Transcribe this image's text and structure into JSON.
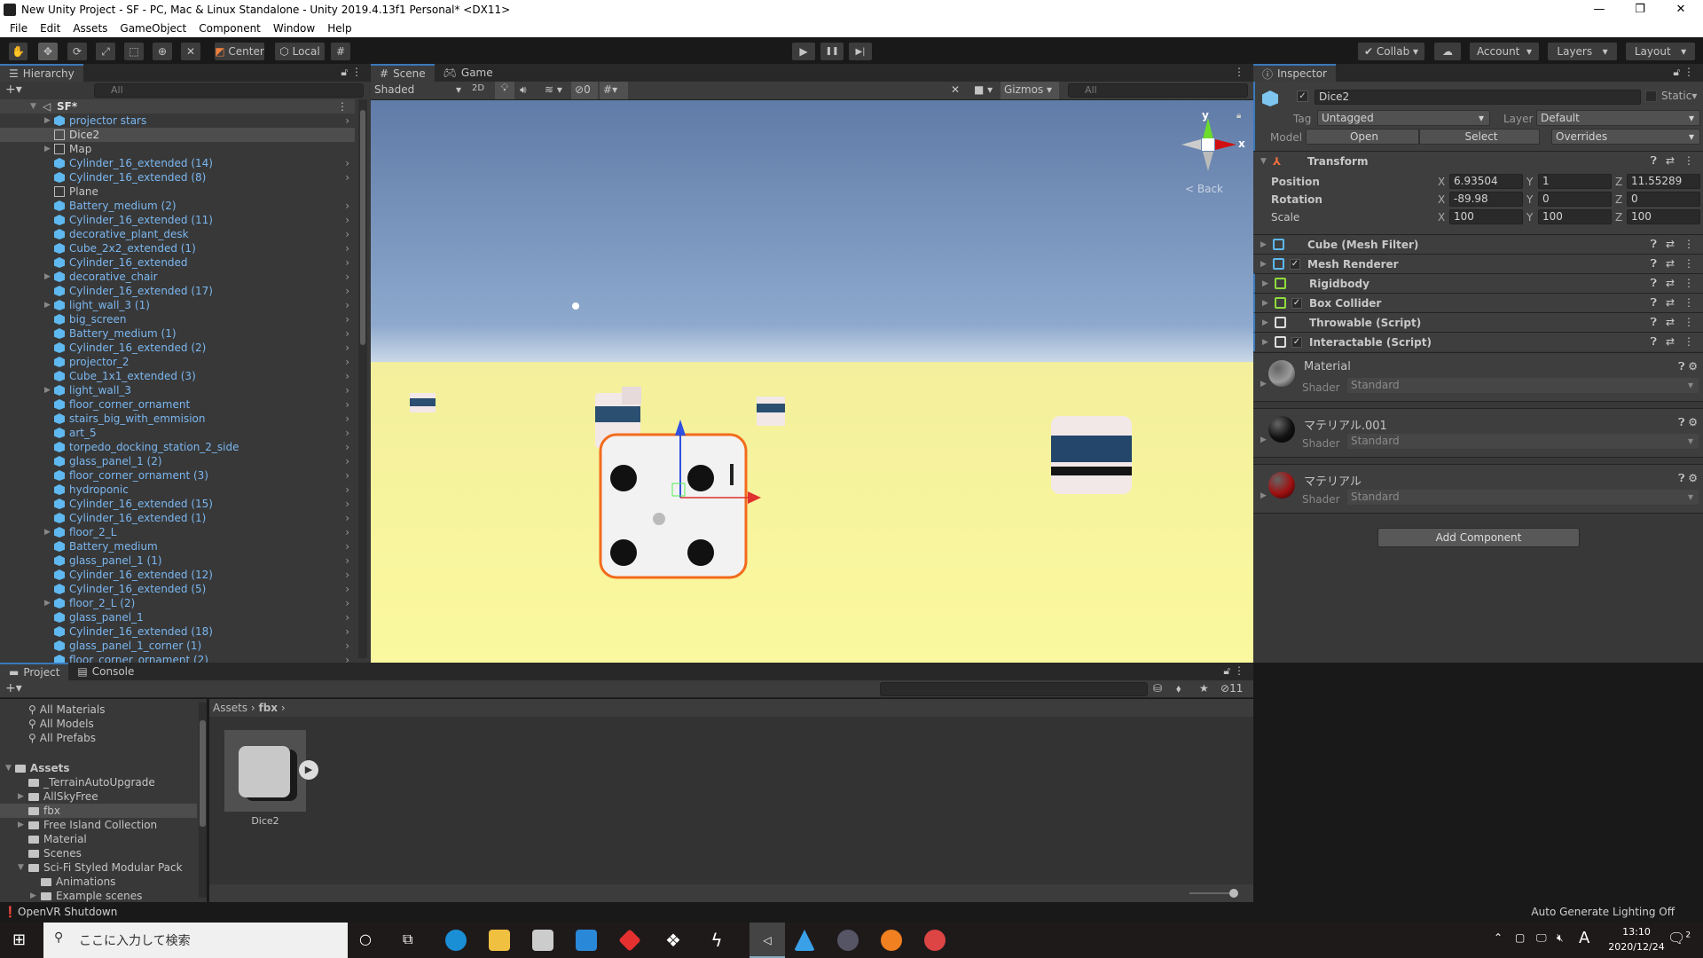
{
  "window": {
    "title": "New Unity Project - SF - PC, Mac & Linux Standalone - Unity 2019.4.13f1 Personal* <DX11>",
    "minimize": "—",
    "restore": "❐",
    "close": "✕"
  },
  "menu": [
    "File",
    "Edit",
    "Assets",
    "GameObject",
    "Component",
    "Window",
    "Help"
  ],
  "toolbar": {
    "tools": [
      "hand-icon",
      "move-icon",
      "rotate-icon",
      "scale-icon",
      "rect-icon",
      "transform-icon",
      "custom-tool-icon"
    ],
    "pivot": "Center",
    "space": "Local",
    "collab": "Collab",
    "account": "Account",
    "layers": "Layers",
    "layout": "Layout",
    "play": "▶",
    "pause": "❚❚",
    "step": "▶|"
  },
  "hierarchy": {
    "tab": "Hierarchy",
    "search_placeholder": "All",
    "scene": "SF*",
    "items": [
      {
        "label": "projector stars",
        "expand": true,
        "type": "prefab"
      },
      {
        "label": "Dice2",
        "expand": false,
        "type": "model",
        "selected": true
      },
      {
        "label": "Map",
        "expand": true,
        "type": "empty"
      },
      {
        "label": "Cylinder_16_extended (14)",
        "type": "prefab"
      },
      {
        "label": "Cylinder_16_extended (8)",
        "type": "prefab"
      },
      {
        "label": "Plane",
        "type": "empty"
      },
      {
        "label": "Battery_medium (2)",
        "type": "prefab"
      },
      {
        "label": "Cylinder_16_extended (11)",
        "type": "prefab"
      },
      {
        "label": "decorative_plant_desk",
        "type": "prefab"
      },
      {
        "label": "Cube_2x2_extended (1)",
        "type": "prefab"
      },
      {
        "label": "Cylinder_16_extended",
        "type": "prefab"
      },
      {
        "label": "decorative_chair",
        "expand": true,
        "type": "prefab"
      },
      {
        "label": "Cylinder_16_extended (17)",
        "type": "prefab"
      },
      {
        "label": "light_wall_3 (1)",
        "expand": true,
        "type": "prefab"
      },
      {
        "label": "big_screen",
        "type": "prefab"
      },
      {
        "label": "Battery_medium (1)",
        "type": "prefab"
      },
      {
        "label": "Cylinder_16_extended (2)",
        "type": "prefab"
      },
      {
        "label": "projector_2",
        "type": "prefab"
      },
      {
        "label": "Cube_1x1_extended (3)",
        "type": "prefab"
      },
      {
        "label": "light_wall_3",
        "expand": true,
        "type": "prefab"
      },
      {
        "label": "floor_corner_ornament",
        "type": "prefab"
      },
      {
        "label": "stairs_big_with_emmision",
        "type": "prefab"
      },
      {
        "label": "art_5",
        "type": "prefab"
      },
      {
        "label": "torpedo_docking_station_2_side",
        "type": "prefab"
      },
      {
        "label": "glass_panel_1 (2)",
        "type": "prefab"
      },
      {
        "label": "floor_corner_ornament (3)",
        "type": "prefab"
      },
      {
        "label": "hydroponic",
        "type": "prefab"
      },
      {
        "label": "Cylinder_16_extended (15)",
        "type": "prefab"
      },
      {
        "label": "Cylinder_16_extended (1)",
        "type": "prefab"
      },
      {
        "label": "floor_2_L",
        "expand": true,
        "type": "prefab"
      },
      {
        "label": "Battery_medium",
        "type": "prefab"
      },
      {
        "label": "glass_panel_1 (1)",
        "type": "prefab"
      },
      {
        "label": "Cylinder_16_extended (12)",
        "type": "prefab"
      },
      {
        "label": "Cylinder_16_extended (5)",
        "type": "prefab"
      },
      {
        "label": "floor_2_L (2)",
        "expand": true,
        "type": "prefab"
      },
      {
        "label": "glass_panel_1",
        "type": "prefab"
      },
      {
        "label": "Cylinder_16_extended (18)",
        "type": "prefab"
      },
      {
        "label": "glass_panel_1_corner (1)",
        "type": "prefab"
      },
      {
        "label": "floor_corner_ornament (2)",
        "type": "prefab"
      }
    ]
  },
  "scene": {
    "tabs": [
      "Scene",
      "Game"
    ],
    "shading": "Shaded",
    "mode2d": "2D",
    "hidden_count": "0",
    "gizmos": "Gizmos",
    "search_placeholder": "All",
    "view_label": "< Back",
    "axis_x": "x",
    "axis_y": "y"
  },
  "inspector": {
    "tab": "Inspector",
    "name": "Dice2",
    "static": "Static",
    "tag_label": "Tag",
    "tag": "Untagged",
    "layer_label": "Layer",
    "layer": "Default",
    "model_label": "Model",
    "open": "Open",
    "select": "Select",
    "overrides": "Overrides",
    "transform": {
      "title": "Transform",
      "rows": [
        {
          "label": "Position",
          "x": "6.93504",
          "y": "1",
          "z": "11.55289"
        },
        {
          "label": "Rotation",
          "x": "-89.98",
          "y": "0",
          "z": "0"
        },
        {
          "label": "Scale",
          "x": "100",
          "y": "100",
          "z": "100"
        }
      ]
    },
    "components": [
      {
        "name": "Cube (Mesh Filter)",
        "checkbox": false,
        "icon": "mesh-filter-icon"
      },
      {
        "name": "Mesh Renderer",
        "checkbox": true,
        "icon": "mesh-renderer-icon"
      },
      {
        "name": "Rigidbody",
        "checkbox": false,
        "icon": "rigidbody-icon"
      },
      {
        "name": "Box Collider",
        "checkbox": true,
        "icon": "box-collider-icon"
      },
      {
        "name": "Throwable (Script)",
        "checkbox": false,
        "icon": "script-icon"
      },
      {
        "name": "Interactable (Script)",
        "checkbox": true,
        "icon": "script-icon"
      }
    ],
    "materials": [
      {
        "name": "Material",
        "shader_label": "Shader",
        "shader": "Standard",
        "color": "#9a9a9a"
      },
      {
        "name": "マテリアル.001",
        "shader_label": "Shader",
        "shader": "Standard",
        "color": "#111111"
      },
      {
        "name": "マテリアル",
        "shader_label": "Shader",
        "shader": "Standard",
        "color": "#a01010"
      }
    ],
    "add_component": "Add Component"
  },
  "project": {
    "tabs": [
      "Project",
      "Console"
    ],
    "favorites": [
      "All Materials",
      "All Models",
      "All Prefabs"
    ],
    "root": "Assets",
    "folders": [
      {
        "label": "_TerrainAutoUpgrade",
        "depth": 1
      },
      {
        "label": "AllSkyFree",
        "depth": 1,
        "expand": true
      },
      {
        "label": "fbx",
        "depth": 1,
        "selected": true
      },
      {
        "label": "Free Island Collection",
        "depth": 1,
        "expand": true
      },
      {
        "label": "Material",
        "depth": 1
      },
      {
        "label": "Scenes",
        "depth": 1
      },
      {
        "label": "Sci-Fi Styled Modular Pack",
        "depth": 1,
        "open": true
      },
      {
        "label": "Animations",
        "depth": 2
      },
      {
        "label": "Example scenes",
        "depth": 2,
        "expand": true
      }
    ],
    "breadcrumb": [
      "Assets",
      "fbx"
    ],
    "assets": [
      {
        "name": "Dice2"
      }
    ],
    "hidden_count": "11"
  },
  "status": {
    "left": "OpenVR Shutdown",
    "right": "Auto Generate Lighting Off"
  },
  "taskbar": {
    "search_placeholder": "ここに入力して検索",
    "time": "13:10",
    "date": "2020/12/24",
    "ime": "A",
    "notifications": "2"
  },
  "colors": {
    "accent": "#3a79bb",
    "hierarchy_prefab": "#7bb7f0",
    "selection_outline": "#f26b1d"
  }
}
